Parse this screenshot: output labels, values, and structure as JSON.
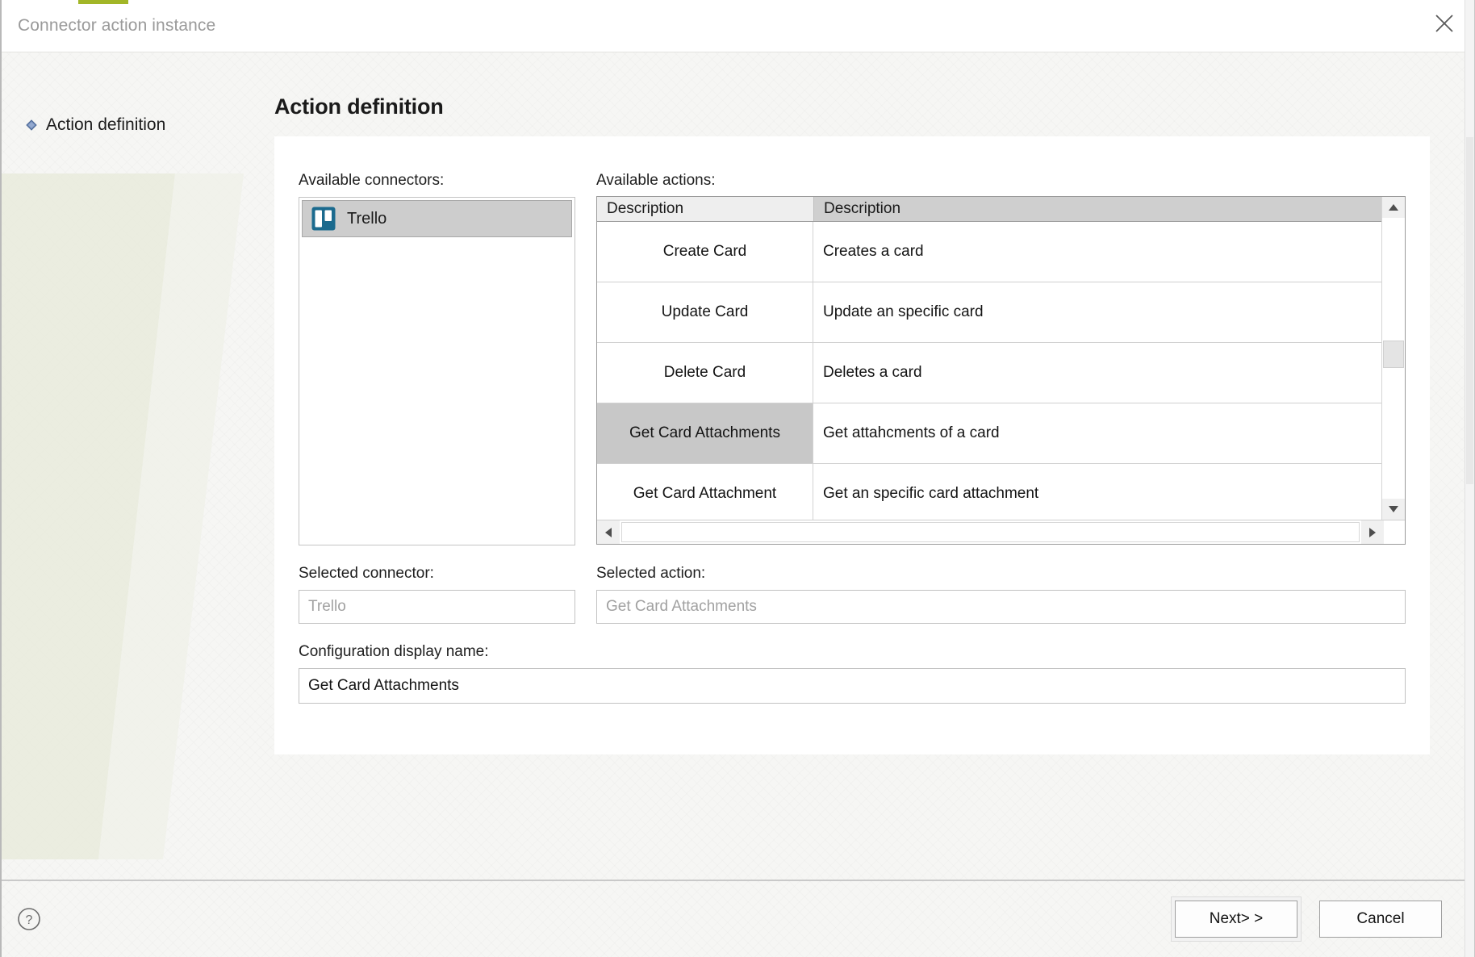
{
  "window": {
    "title": "Connector action instance",
    "close_icon": "close-icon"
  },
  "sidebar": {
    "items": [
      {
        "label": "Action definition",
        "bullet_icon": "diamond-bullet-icon"
      }
    ]
  },
  "main": {
    "page_title": "Action definition",
    "connectors": {
      "label": "Available connectors:",
      "items": [
        {
          "label": "Trello",
          "icon": "trello-icon",
          "selected": true
        }
      ]
    },
    "actions": {
      "label": "Available actions:",
      "columns": [
        "Description",
        "Description"
      ],
      "rows": [
        {
          "name": "Create Card",
          "description": "Creates a card",
          "selected": false
        },
        {
          "name": "Update Card",
          "description": "Update an specific card",
          "selected": false
        },
        {
          "name": "Delete Card",
          "description": "Deletes a card",
          "selected": false
        },
        {
          "name": "Get Card Attachments",
          "description": "Get attahcments of a card",
          "selected": true
        },
        {
          "name": "Get Card Attachment",
          "description": "Get an specific card attachment",
          "selected": false
        }
      ],
      "scroll_up_icon": "scroll-up-arrow-icon",
      "scroll_down_icon": "scroll-down-arrow-icon",
      "scroll_left_icon": "scroll-left-arrow-icon",
      "scroll_right_icon": "scroll-right-arrow-icon"
    },
    "selected_connector": {
      "label": "Selected connector:",
      "value": "Trello"
    },
    "selected_action": {
      "label": "Selected action:",
      "value": "Get Card Attachments"
    },
    "config_display_name": {
      "label": "Configuration display name:",
      "value": "Get Card Attachments"
    }
  },
  "footer": {
    "help_icon": "help-question-icon",
    "next_label": "Next> >",
    "cancel_label": "Cancel"
  },
  "colors": {
    "accent_green": "#a2b627",
    "trello_blue": "#1b6a8e",
    "selection_gray": "#c8c8c8",
    "title_text": "#9a9a9a"
  }
}
